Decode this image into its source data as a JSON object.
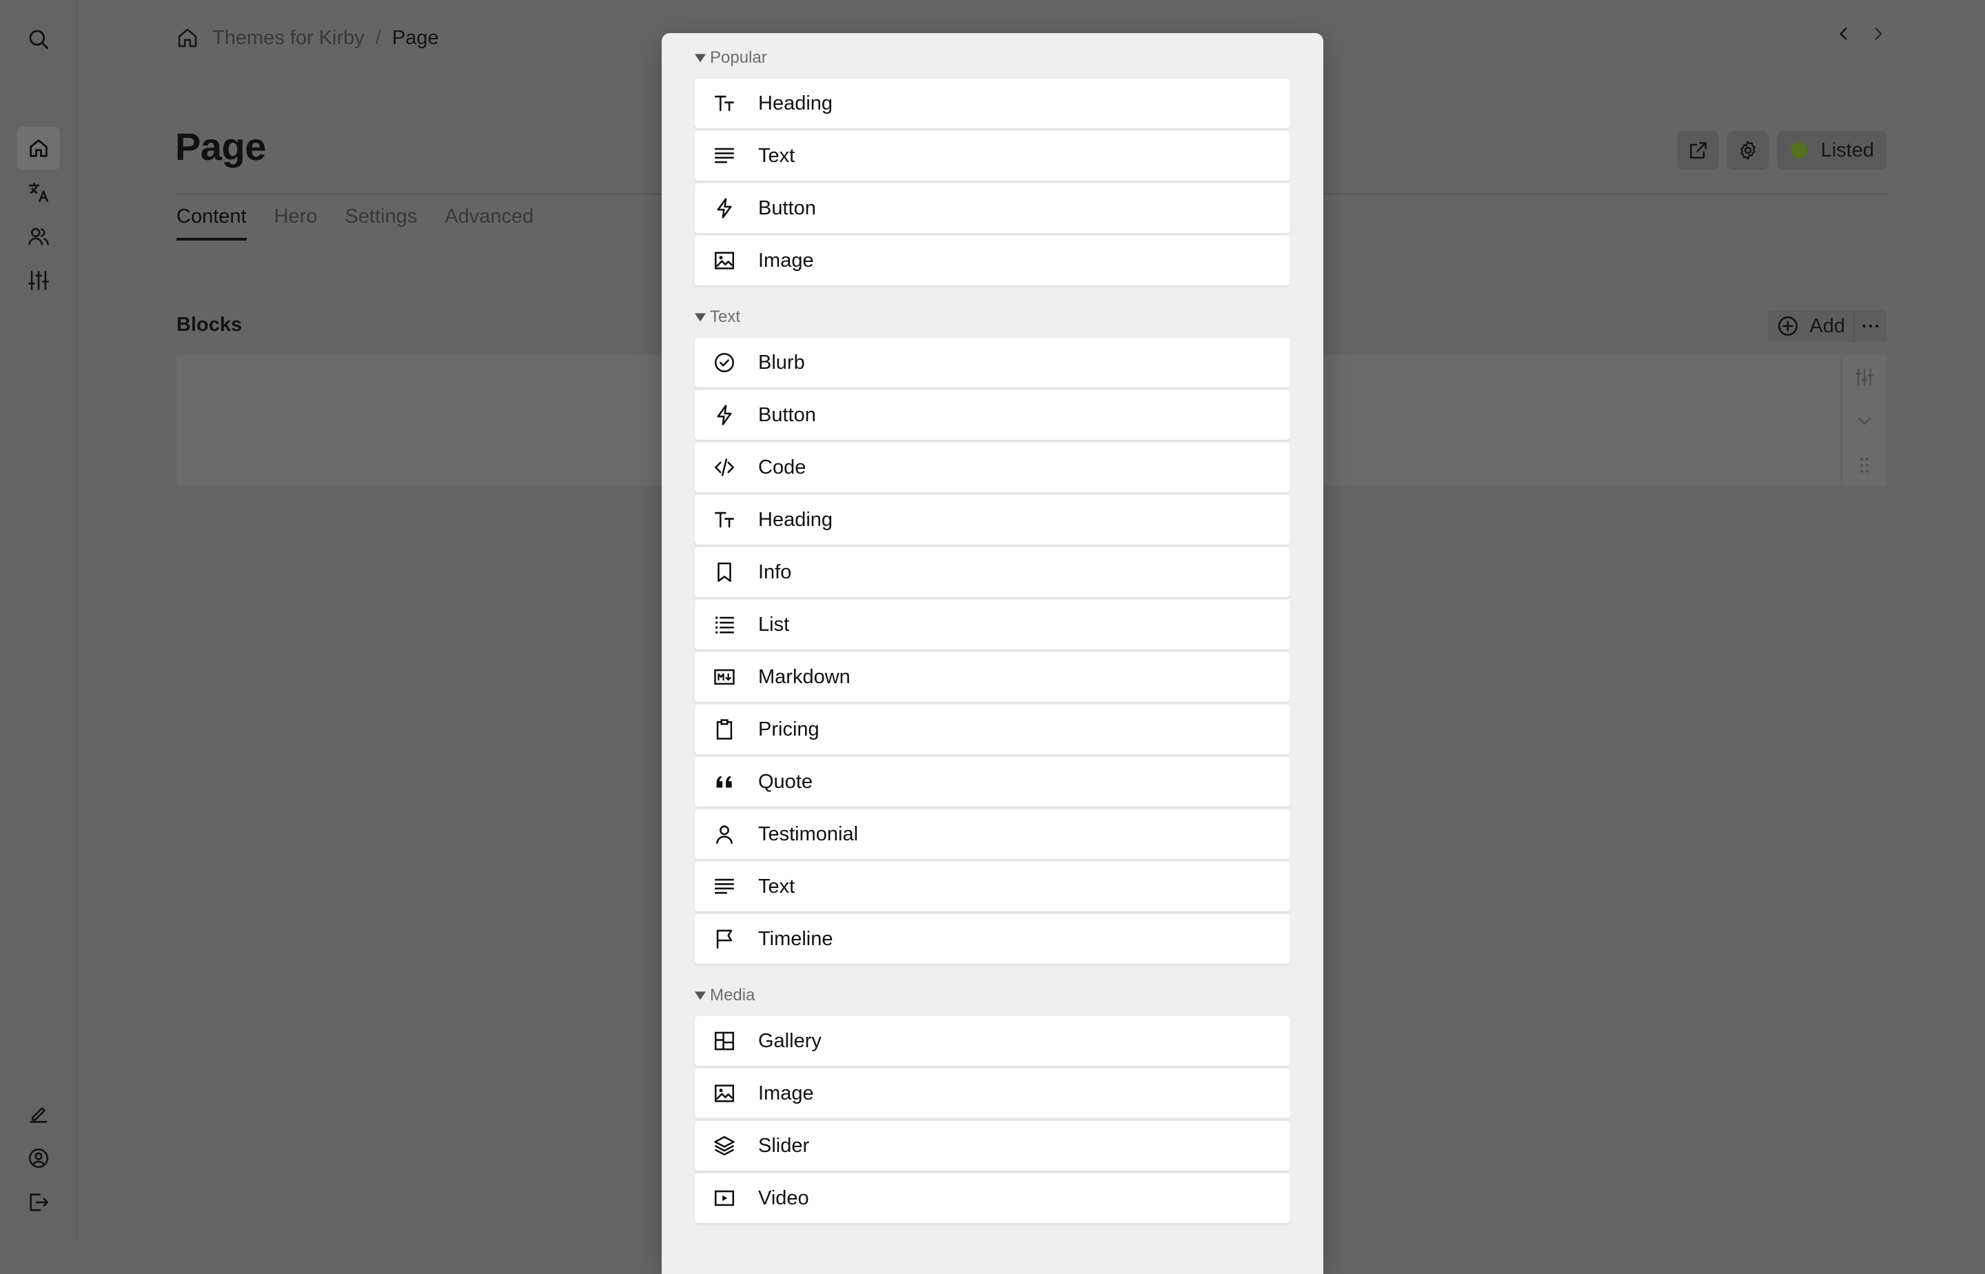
{
  "breadcrumb": {
    "site": "Themes for Kirby",
    "separator": "/",
    "current": "Page"
  },
  "page": {
    "title": "Page"
  },
  "header_buttons": {
    "status_label": "Listed",
    "status_color": "#55701e"
  },
  "tabs": [
    {
      "label": "Content",
      "active": true
    },
    {
      "label": "Hero",
      "active": false
    },
    {
      "label": "Settings",
      "active": false
    },
    {
      "label": "Advanced",
      "active": false
    }
  ],
  "blocks_section": {
    "label": "Blocks",
    "add_label": "Add"
  },
  "dialog": {
    "groups": [
      {
        "title": "Popular",
        "items": [
          {
            "label": "Heading",
            "icon": "title-icon"
          },
          {
            "label": "Text",
            "icon": "text-icon"
          },
          {
            "label": "Button",
            "icon": "bolt-icon"
          },
          {
            "label": "Image",
            "icon": "image-icon"
          }
        ]
      },
      {
        "title": "Text",
        "items": [
          {
            "label": "Blurb",
            "icon": "check-circle-icon"
          },
          {
            "label": "Button",
            "icon": "bolt-icon"
          },
          {
            "label": "Code",
            "icon": "code-icon"
          },
          {
            "label": "Heading",
            "icon": "title-icon"
          },
          {
            "label": "Info",
            "icon": "bookmark-icon"
          },
          {
            "label": "List",
            "icon": "list-icon"
          },
          {
            "label": "Markdown",
            "icon": "markdown-icon"
          },
          {
            "label": "Pricing",
            "icon": "clipboard-icon"
          },
          {
            "label": "Quote",
            "icon": "quote-icon"
          },
          {
            "label": "Testimonial",
            "icon": "user-icon"
          },
          {
            "label": "Text",
            "icon": "text-icon"
          },
          {
            "label": "Timeline",
            "icon": "flag-icon"
          }
        ]
      },
      {
        "title": "Media",
        "items": [
          {
            "label": "Gallery",
            "icon": "dashboard-icon"
          },
          {
            "label": "Image",
            "icon": "image-icon"
          },
          {
            "label": "Slider",
            "icon": "layers-icon"
          },
          {
            "label": "Video",
            "icon": "video-icon"
          }
        ]
      }
    ]
  }
}
